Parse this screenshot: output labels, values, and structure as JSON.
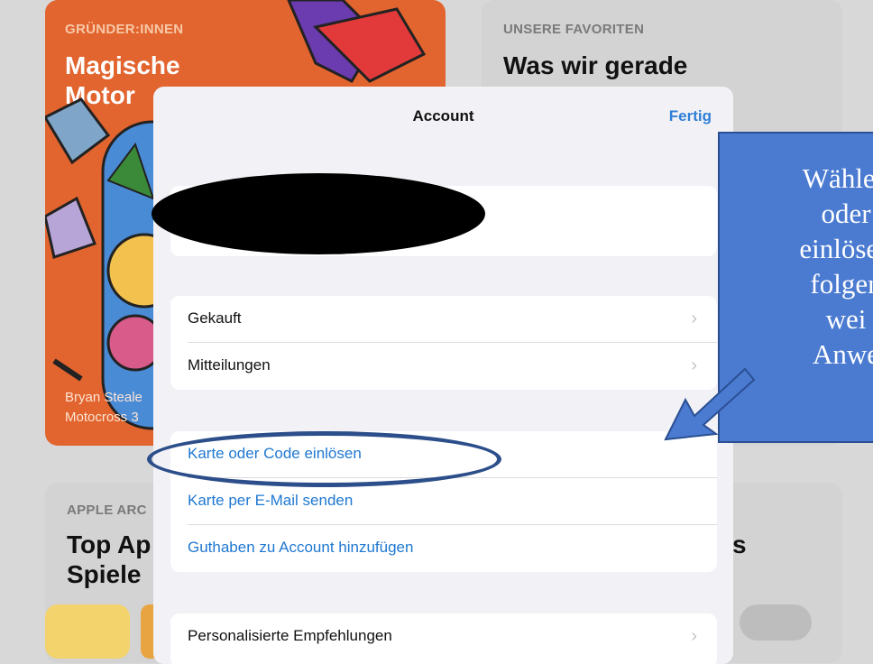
{
  "background": {
    "card1": {
      "category": "GRÜNDER:INNEN",
      "title": "Magische Motor",
      "subtitle_line1": "Bryan Steale",
      "subtitle_line2": "Motocross 3"
    },
    "card2": {
      "category": "UNSERE FAVORITEN",
      "title": "Was wir gerade"
    },
    "card3": {
      "category": "APPLE ARC",
      "title": "Top Ap\nSpiele",
      "partial_right": "s"
    }
  },
  "sheet": {
    "title": "Account",
    "done_label": "Fertig",
    "group1": [
      {
        "label": "Gekauft"
      },
      {
        "label": "Mitteilungen"
      }
    ],
    "group2": [
      {
        "label": "Karte oder Code einlösen"
      },
      {
        "label": "Karte per E-Mail senden"
      },
      {
        "label": "Guthaben zu Account hinzufügen"
      }
    ],
    "group3": [
      {
        "label": "Personalisierte Empfehlungen"
      }
    ]
  },
  "annotation": {
    "callout_text": "Wählen\noder\neinlösen\nfolgen\nwei\nAnwe"
  },
  "colors": {
    "accent": "#2f7fd6",
    "callout_bg": "#4b7bd1",
    "orange_card": "#e2642e"
  }
}
